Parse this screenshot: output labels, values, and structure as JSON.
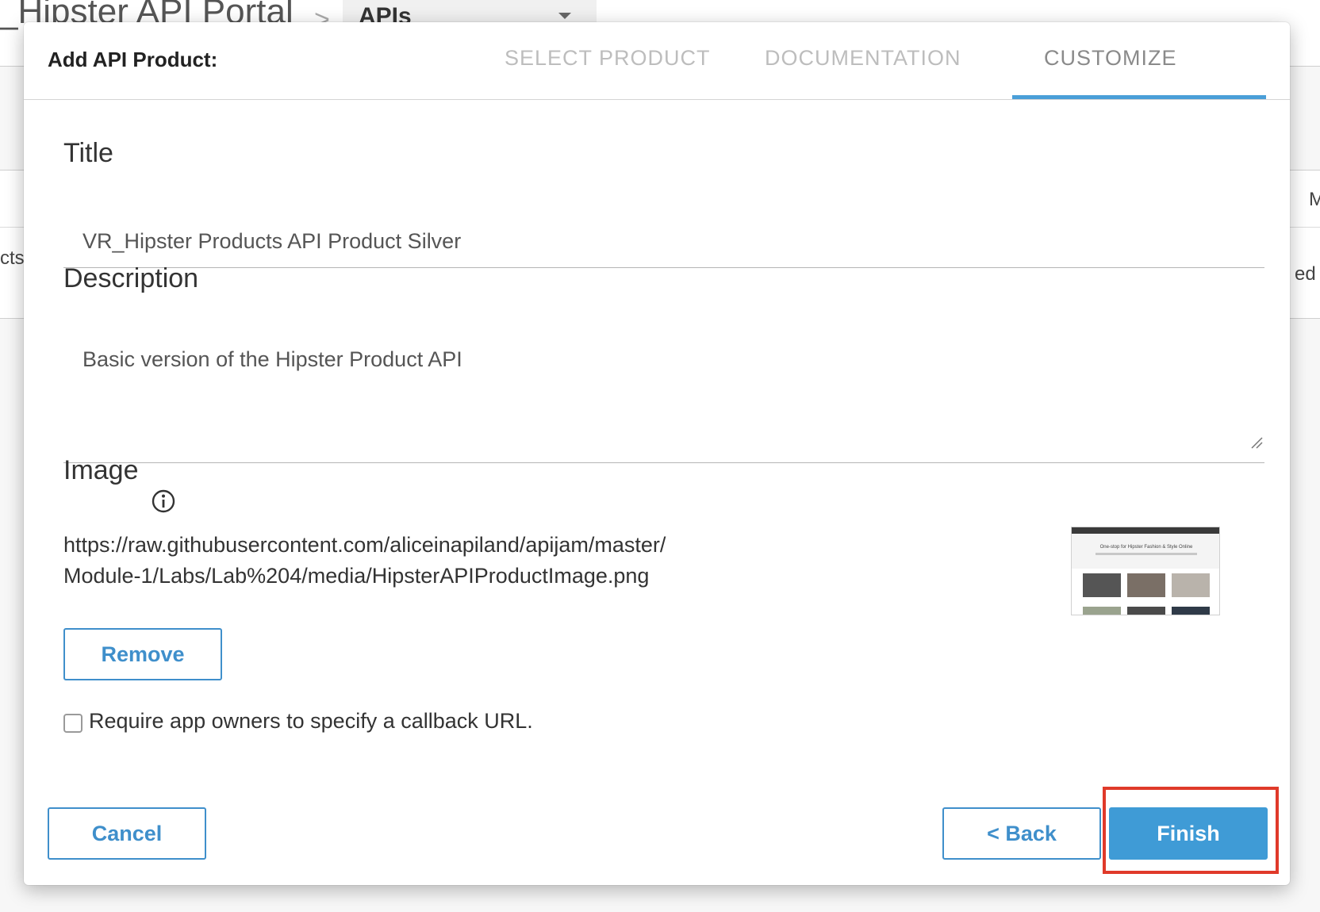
{
  "background": {
    "breadcrumb_title": "_Hipster API Portal",
    "breadcrumb_separator": ">",
    "dropdown_value": "APIs",
    "left_cell_fragment": "cts",
    "right_header_fragment": "M",
    "right_cell_fragment": "ed"
  },
  "modal": {
    "title": "Add API Product:",
    "steps": [
      {
        "label": "SELECT PRODUCT",
        "active": false
      },
      {
        "label": "DOCUMENTATION",
        "active": false
      },
      {
        "label": "CUSTOMIZE",
        "active": true
      }
    ],
    "fields": {
      "title_label": "Title",
      "title_value": "VR_Hipster Products API Product Silver",
      "description_label": "Description",
      "description_value": "Basic version of the Hipster Product API",
      "image_label": "Image",
      "image_url": "https://raw.githubusercontent.com/aliceinapiland/apijam/master/Module-1/Labs/Lab%204/media/HipsterAPIProductImage.png",
      "image_thumbnail_headline": "One-stop for Hipster Fashion & Style Online",
      "remove_label": "Remove",
      "callback_checkbox_label": "Require app owners to specify a callback URL.",
      "callback_checked": false
    },
    "footer": {
      "cancel_label": "Cancel",
      "back_label": "< Back",
      "finish_label": "Finish"
    }
  },
  "colors": {
    "accent": "#3f9bd6",
    "highlight": "#e03a2a",
    "step_indicator": "#4a9fd8"
  }
}
